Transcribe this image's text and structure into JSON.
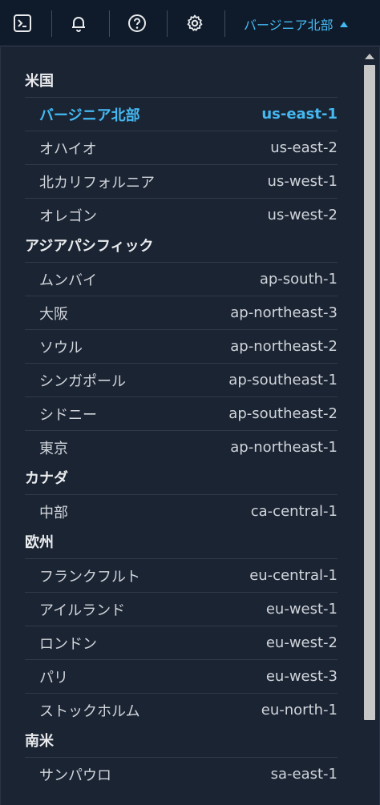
{
  "topbar": {
    "icons": [
      "cloudshell-icon",
      "bell-icon",
      "help-icon",
      "gear-icon"
    ],
    "region_label": "バージニア北部",
    "accent": "#44b9f2"
  },
  "groups": [
    {
      "title": "米国",
      "items": [
        {
          "name": "バージニア北部",
          "code": "us-east-1",
          "selected": true
        },
        {
          "name": "オハイオ",
          "code": "us-east-2"
        },
        {
          "name": "北カリフォルニア",
          "code": "us-west-1"
        },
        {
          "name": "オレゴン",
          "code": "us-west-2"
        }
      ]
    },
    {
      "title": "アジアパシフィック",
      "items": [
        {
          "name": "ムンバイ",
          "code": "ap-south-1"
        },
        {
          "name": "大阪",
          "code": "ap-northeast-3"
        },
        {
          "name": "ソウル",
          "code": "ap-northeast-2"
        },
        {
          "name": "シンガポール",
          "code": "ap-southeast-1"
        },
        {
          "name": "シドニー",
          "code": "ap-southeast-2"
        },
        {
          "name": "東京",
          "code": "ap-northeast-1"
        }
      ]
    },
    {
      "title": "カナダ",
      "items": [
        {
          "name": "中部",
          "code": "ca-central-1"
        }
      ]
    },
    {
      "title": "欧州",
      "items": [
        {
          "name": "フランクフルト",
          "code": "eu-central-1"
        },
        {
          "name": "アイルランド",
          "code": "eu-west-1"
        },
        {
          "name": "ロンドン",
          "code": "eu-west-2"
        },
        {
          "name": "パリ",
          "code": "eu-west-3"
        },
        {
          "name": "ストックホルム",
          "code": "eu-north-1"
        }
      ]
    },
    {
      "title": "南米",
      "items": [
        {
          "name": "サンパウロ",
          "code": "sa-east-1"
        }
      ]
    }
  ]
}
